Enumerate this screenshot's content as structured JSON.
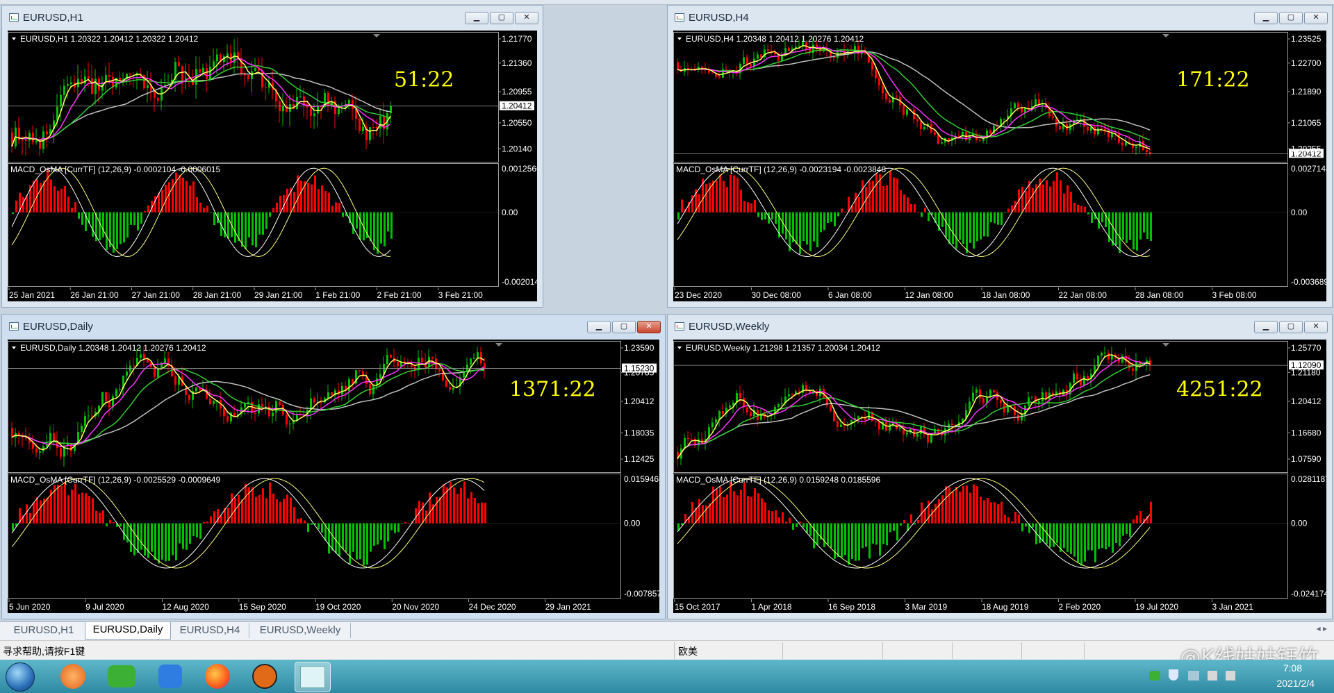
{
  "windows": [
    {
      "title": "EURUSD,H1",
      "ohlc_label": "EURUSD,H1  1.20322 1.20412 1.20322 1.20412",
      "timer": "51:22",
      "price_axis": [
        "1.21770",
        "1.21360",
        "1.20955",
        "1.20550",
        "1.20412",
        "1.20140"
      ],
      "macd_label": "MACD_OsMA [CurrTF] (12,26,9) -0.0002104 -0.0006015",
      "macd_axis": [
        "0.0012566",
        "0.00",
        "-0.0020148"
      ],
      "time_axis": [
        "25 Jan 2021",
        "26 Jan 21:00",
        "27 Jan 21:00",
        "28 Jan 21:00",
        "29 Jan 21:00",
        "1 Feb 21:00",
        "2 Feb 21:00",
        "3 Feb 21:00"
      ]
    },
    {
      "title": "EURUSD,H4",
      "ohlc_label": "EURUSD,H4  1.20348 1.20412 1.20276 1.20412",
      "timer": "171:22",
      "price_axis": [
        "1.23525",
        "1.22700",
        "1.21890",
        "1.21065",
        "1.20412",
        "1.20255"
      ],
      "macd_label": "MACD_OsMA [CurrTF] (12,26,9) -0.0023194 -0.0023848",
      "macd_axis": [
        "0.0027143",
        "0.00",
        "-0.0036893"
      ],
      "time_axis": [
        "23 Dec 2020",
        "30 Dec 08:00",
        "6 Jan 08:00",
        "12 Jan 08:00",
        "18 Jan 08:00",
        "22 Jan 08:00",
        "28 Jan 08:00",
        "3 Feb 08:00"
      ]
    },
    {
      "title": "EURUSD,Daily",
      "ohlc_label": "EURUSD,Daily  1.20348 1.20412 1.20276 1.20412",
      "timer": "1371:22",
      "price_axis": [
        "1.23590",
        "1.20785",
        "1.20412",
        "1.18035",
        "1.15230",
        "1.12425"
      ],
      "macd_label": "MACD_OsMA [CurrTF] (12,26,9) -0.0025529 -0.0009649",
      "macd_axis": [
        "0.0159468",
        "0.00",
        "-0.0078573"
      ],
      "time_axis": [
        "5 Jun 2020",
        "9 Jul 2020",
        "12 Aug 2020",
        "15 Sep 2020",
        "19 Oct 2020",
        "20 Nov 2020",
        "24 Dec 2020",
        "29 Jan 2021"
      ]
    },
    {
      "title": "EURUSD,Weekly",
      "ohlc_label": "EURUSD,Weekly  1.21298 1.21357 1.20034 1.20412",
      "timer": "4251:22",
      "price_axis": [
        "1.25770",
        "1.21180",
        "1.20412",
        "1.16680",
        "1.12090",
        "1.07590"
      ],
      "macd_label": "MACD_OsMA [CurrTF] (12,26,9) 0.0159248 0.0185596",
      "macd_axis": [
        "0.0281187",
        "0.00",
        "-0.0241742"
      ],
      "time_axis": [
        "15 Oct 2017",
        "1 Apr 2018",
        "16 Sep 2018",
        "3 Mar 2019",
        "18 Aug 2019",
        "2 Feb 2020",
        "19 Jul 2020",
        "3 Jan 2021"
      ]
    }
  ],
  "tabs": [
    "EURUSD,H1",
    "EURUSD,Daily",
    "EURUSD,H4",
    "EURUSD,Weekly"
  ],
  "active_tab": "EURUSD,Daily",
  "status": {
    "help": "寻求帮助,请按F1键",
    "profile": "欧美"
  },
  "taskbar": {
    "time": "7:08",
    "date": "2021/2/4"
  },
  "watermark": "@K线姑姑钰竹",
  "colors": {
    "chart_bg": "#000000",
    "bull": "#00c000",
    "bear": "#ff0000",
    "ma_yellow": "#ffff66",
    "ma_magenta": "#ff33ff",
    "ma_green": "#33cc33",
    "ma_gray": "#c0c0c0",
    "timer": "#ffff00"
  }
}
